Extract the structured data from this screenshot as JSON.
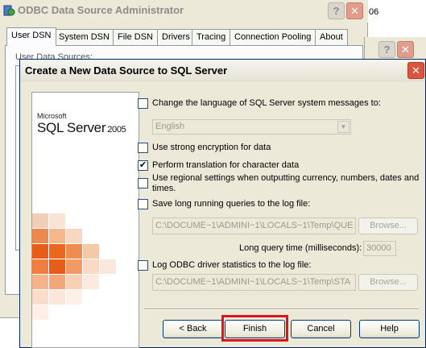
{
  "background_window": {
    "title": "ODBC Data Source Administrator",
    "peek_text": "06",
    "tabs": [
      "User DSN",
      "System DSN",
      "File DSN",
      "Drivers",
      "Tracing",
      "Connection Pooling",
      "About"
    ],
    "active_tab": "User DSN",
    "panel_label": "User Data Sources:",
    "help_glyph": "?",
    "close_glyph": "✕"
  },
  "dialog": {
    "title": "Create a New Data Source to SQL Server",
    "close_glyph": "✕",
    "banner": {
      "brand_small": "Microsoft",
      "product": "SQL Server",
      "version": "2005"
    },
    "options": {
      "change_language": {
        "label": "Change the language of SQL Server system messages to:",
        "checked": false
      },
      "language_value": "English",
      "strong_encryption": {
        "label": "Use strong encryption for data",
        "checked": false
      },
      "char_translation": {
        "label": "Perform translation for character data",
        "checked": true
      },
      "regional_settings": {
        "label_line1": "Use regional settings when outputting currency, numbers, dates and",
        "label_line2": "times.",
        "checked": false
      },
      "save_long_queries": {
        "label": "Save long running queries to the log file:",
        "checked": false
      },
      "query_log_path": "C:\\DOCUME~1\\ADMINI~1\\LOCALS~1\\Temp\\QUE",
      "browse_label": "Browse...",
      "long_query_label": "Long query time (milliseconds):",
      "long_query_value": "30000",
      "log_driver_stats": {
        "label": "Log ODBC driver statistics to the log file:",
        "checked": false
      },
      "stats_log_path": "C:\\DOCUME~1\\ADMINI~1\\LOCALS~1\\Temp\\STA",
      "check_glyph": "✔"
    },
    "buttons": {
      "back": "< Back",
      "finish": "Finish",
      "cancel": "Cancel",
      "help": "Help"
    }
  },
  "colors": {
    "highlight": "#e0121b",
    "banner_orange": "#e85c1a"
  }
}
